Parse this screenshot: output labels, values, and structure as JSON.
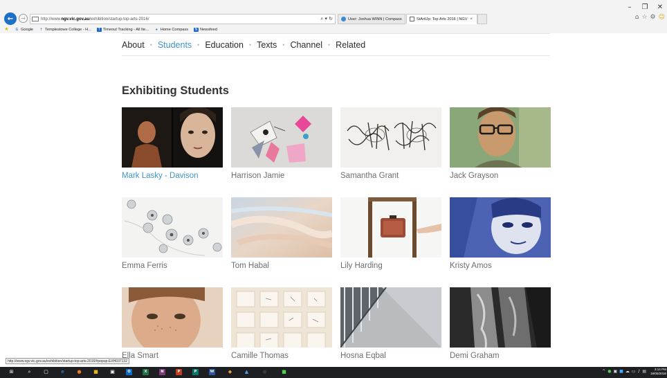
{
  "browser": {
    "url_prefix": "http://www.",
    "url_domain": "ngv.vic.gov.au",
    "url_path": "/exhibition/startup-top-arts-2016/",
    "address_tools": "⌕ ▾ ↻",
    "tabs": [
      {
        "label": "User: Joshua WINN | Compass",
        "icon": "compass-icon"
      },
      {
        "label": "StArtUp: Top Arts 2016 | NGV",
        "icon": "ngv-icon",
        "close": "×"
      }
    ],
    "window_controls": [
      "–",
      "❐",
      "✕"
    ],
    "favorites": [
      {
        "label": "Google",
        "icon": "google-icon"
      },
      {
        "label": "Templestowe College - H...",
        "icon": "templestowe-icon"
      },
      {
        "label": "Timeout Tracking - All Ite...",
        "icon": "timeout-icon"
      },
      {
        "label": "Home  Compass",
        "icon": "compass-icon"
      },
      {
        "label": "Newsfeed",
        "icon": "newsfeed-icon"
      }
    ],
    "status_url": "http://www.ngv.vic.gov.au/exhibition/startup-top-arts-2016/#popup-EXH037132"
  },
  "topnav": {
    "items": [
      {
        "label": "About",
        "active": false
      },
      {
        "label": "Students",
        "active": true
      },
      {
        "label": "Education",
        "active": false
      },
      {
        "label": "Texts",
        "active": false
      },
      {
        "label": "Channel",
        "active": false
      },
      {
        "label": "Related",
        "active": false
      }
    ],
    "separator": "•"
  },
  "section": {
    "title": "Exhibiting Students"
  },
  "students": [
    {
      "name": "Mark Lasky - Davison",
      "highlight": true
    },
    {
      "name": "Harrison Jamie",
      "highlight": false
    },
    {
      "name": "Samantha Grant",
      "highlight": false
    },
    {
      "name": "Jack Grayson",
      "highlight": false
    },
    {
      "name": "Emma Ferris",
      "highlight": false
    },
    {
      "name": "Tom Habal",
      "highlight": false
    },
    {
      "name": "Lily Harding",
      "highlight": false
    },
    {
      "name": "Kristy Amos",
      "highlight": false
    },
    {
      "name": "Ella Smart",
      "highlight": false
    },
    {
      "name": "Camille Thomas",
      "highlight": false
    },
    {
      "name": "Hosna Eqbal",
      "highlight": false
    },
    {
      "name": "Demi Graham",
      "highlight": false
    }
  ],
  "taskbar": {
    "time": "3:14 PM",
    "date": "18/05/2016"
  },
  "colors": {
    "accent": "#3e95c9",
    "text": "#333333",
    "caption": "#6d6d6d",
    "taskbar": "#1e1f23"
  }
}
